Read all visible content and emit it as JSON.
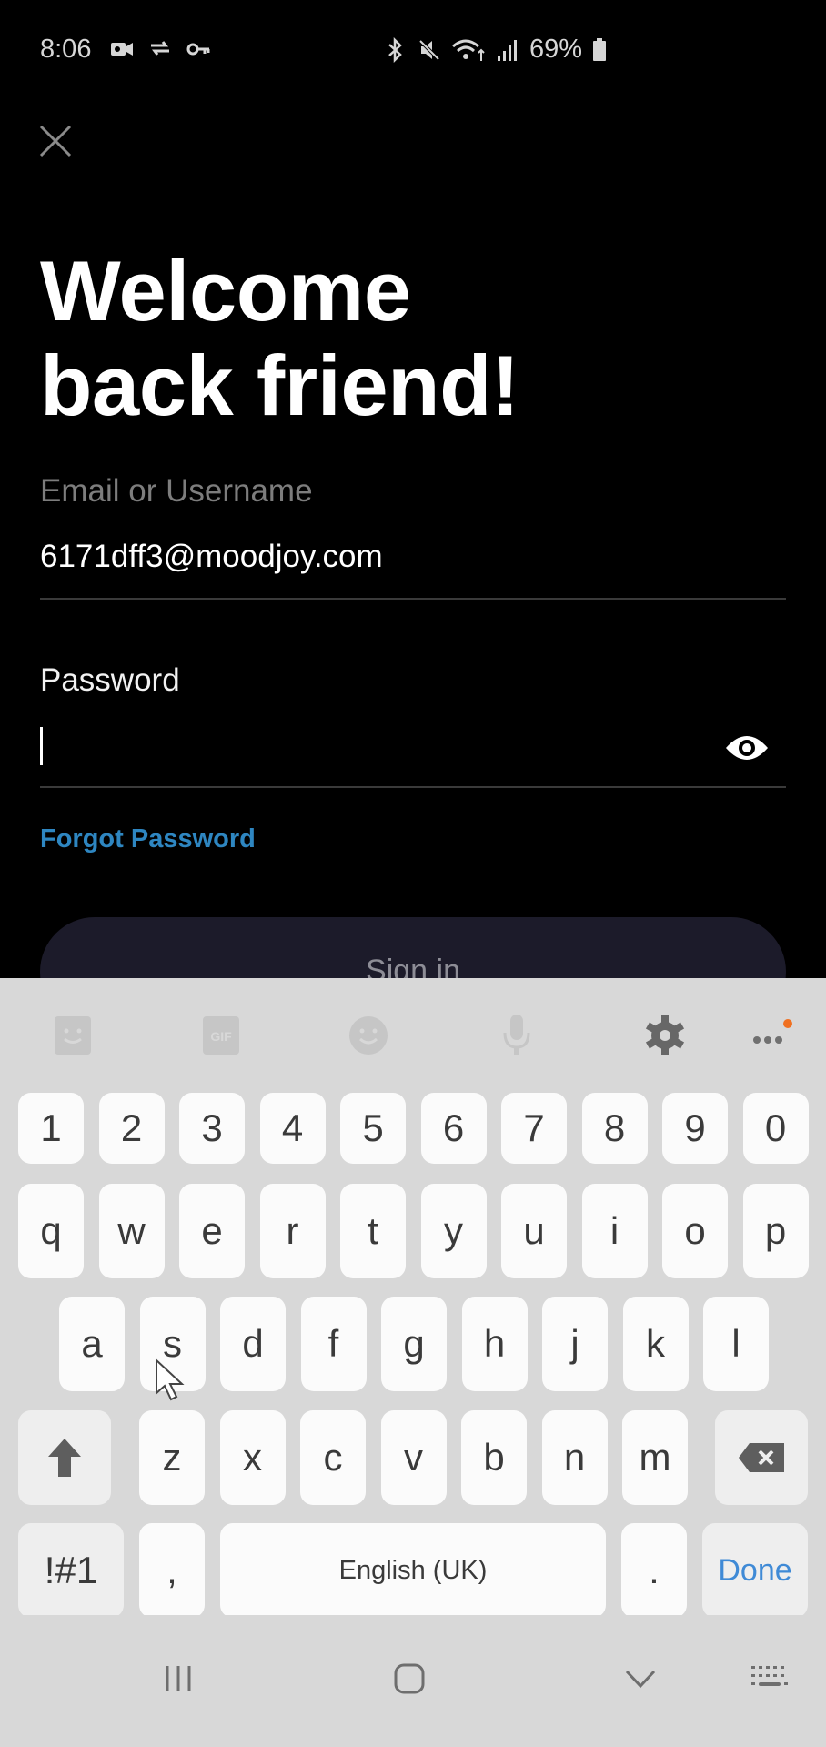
{
  "status_bar": {
    "time": "8:06",
    "left_icons": [
      "video-call-icon",
      "sync-icon",
      "vpn-key-icon"
    ],
    "right_icons": [
      "bluetooth-icon",
      "mute-icon",
      "wifi-icon",
      "signal-icon"
    ],
    "battery": "69%"
  },
  "screen": {
    "close_icon": "close-icon",
    "title_line1": "Welcome",
    "title_line2": "back friend!",
    "email_label": "Email or Username",
    "email_value": "6171dff3@moodjoy.com",
    "password_label": "Password",
    "password_value": "",
    "forgot_password": "Forgot Password",
    "sign_in": "Sign in",
    "colors": {
      "link": "#2e86c1",
      "button_bg": "#1c1b2a",
      "done": "#3f8ad6",
      "notification_dot": "#f07020"
    }
  },
  "keyboard": {
    "toolbar": [
      "sticker-icon",
      "gif-icon",
      "emoji-icon",
      "mic-icon",
      "settings-icon",
      "more-icon"
    ],
    "row_numbers": [
      "1",
      "2",
      "3",
      "4",
      "5",
      "6",
      "7",
      "8",
      "9",
      "0"
    ],
    "row1": [
      "q",
      "w",
      "e",
      "r",
      "t",
      "y",
      "u",
      "i",
      "o",
      "p"
    ],
    "row2": [
      "a",
      "s",
      "d",
      "f",
      "g",
      "h",
      "j",
      "k",
      "l"
    ],
    "row3": [
      "z",
      "x",
      "c",
      "v",
      "b",
      "n",
      "m"
    ],
    "symbols_key": "!#1",
    "comma_key": ",",
    "space_label": "English (UK)",
    "period_key": ".",
    "done_key": "Done"
  },
  "navbar": {
    "buttons": [
      "recents-icon",
      "home-icon",
      "hide-keyboard-icon",
      "keyboard-switch-icon"
    ]
  }
}
